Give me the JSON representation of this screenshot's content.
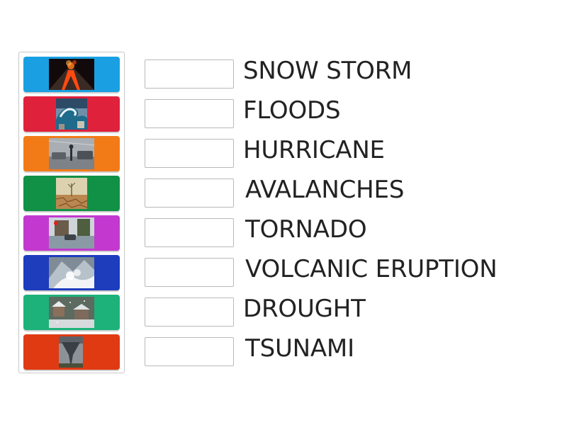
{
  "activity": {
    "tiles": [
      {
        "color": "#1aa0e2",
        "image": "volcano-eruption-photo"
      },
      {
        "color": "#e0213c",
        "image": "tsunami-wave-photo"
      },
      {
        "color": "#f27b18",
        "image": "hurricane-street-photo"
      },
      {
        "color": "#109146",
        "image": "drought-cracked-earth-photo"
      },
      {
        "color": "#c339cf",
        "image": "flooded-street-photo"
      },
      {
        "color": "#1d3dbd",
        "image": "avalanche-snow-photo"
      },
      {
        "color": "#1db27a",
        "image": "snow-storm-town-photo"
      },
      {
        "color": "#e03a12",
        "image": "tornado-funnel-photo"
      }
    ],
    "words": [
      {
        "label": "SNOW STORM"
      },
      {
        "label": "FLOODS"
      },
      {
        "label": "HURRICANE"
      },
      {
        "label": "AVALANCHES"
      },
      {
        "label": "TORNADO"
      },
      {
        "label": "VOLCANIC ERUPTION"
      },
      {
        "label": "DROUGHT"
      },
      {
        "label": "TSUNAMI"
      }
    ]
  }
}
